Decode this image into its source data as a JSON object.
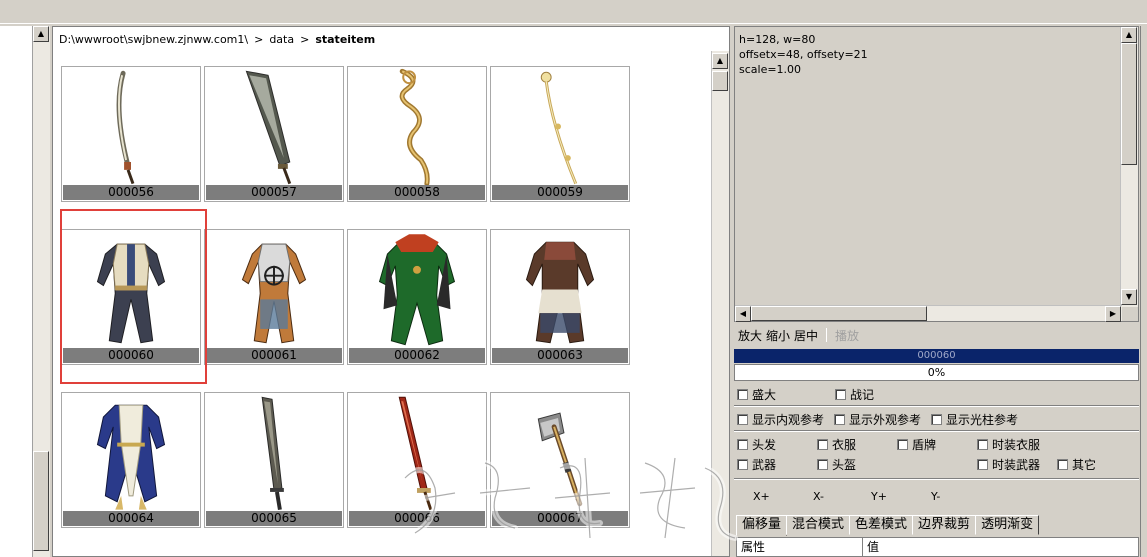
{
  "breadcrumb": [
    "D:\\wwwroot\\swjbnew.zjnww.com1\\",
    ">",
    "data",
    ">",
    "stateitem"
  ],
  "items": [
    {
      "label": "000056",
      "kind": "sword-curved"
    },
    {
      "label": "000057",
      "kind": "sword-broad"
    },
    {
      "label": "000058",
      "kind": "staff-twisted"
    },
    {
      "label": "000059",
      "kind": "staff-gold"
    },
    {
      "label": "000060",
      "kind": "armor-white"
    },
    {
      "label": "000061",
      "kind": "armor-orange"
    },
    {
      "label": "000062",
      "kind": "armor-green"
    },
    {
      "label": "000063",
      "kind": "armor-brown"
    },
    {
      "label": "000064",
      "kind": "robe-blue"
    },
    {
      "label": "000065",
      "kind": "sword-dark"
    },
    {
      "label": "000066",
      "kind": "sword-red"
    },
    {
      "label": "000067",
      "kind": "axe"
    }
  ],
  "selected_index": 4,
  "info": {
    "text": "h=128, w=80\noffsetx=48, offsety=21\nscale=1.00"
  },
  "zoom": {
    "zoom_in": "放大",
    "zoom_out": "缩小",
    "center": "居中",
    "play": "播放"
  },
  "current_name": "000060",
  "progress": {
    "text": "0%",
    "value": 0
  },
  "checkboxes": {
    "shengda": "盛大",
    "zhanji": "战记",
    "show_inner": "显示内观参考",
    "show_outer": "显示外观参考",
    "show_beam": "显示光柱参考",
    "hair": "头发",
    "clothes": "衣服",
    "shield": "盾牌",
    "fashion_clothes": "时装衣服",
    "weapon": "武器",
    "helmet": "头盔",
    "fashion_weapon": "时装武器",
    "other": "其它"
  },
  "axis": {
    "xplus": "X+",
    "xminus": "X-",
    "yplus": "Y+",
    "yminus": "Y-"
  },
  "tabs": [
    "偏移量",
    "混合模式",
    "色差模式",
    "边界裁剪",
    "透明渐变"
  ],
  "prop_header": {
    "property": "属性",
    "value": "值"
  },
  "colors": {
    "selection": "#e0403a",
    "name_bar": "#0a246a",
    "caption": "#7d7d7d"
  }
}
